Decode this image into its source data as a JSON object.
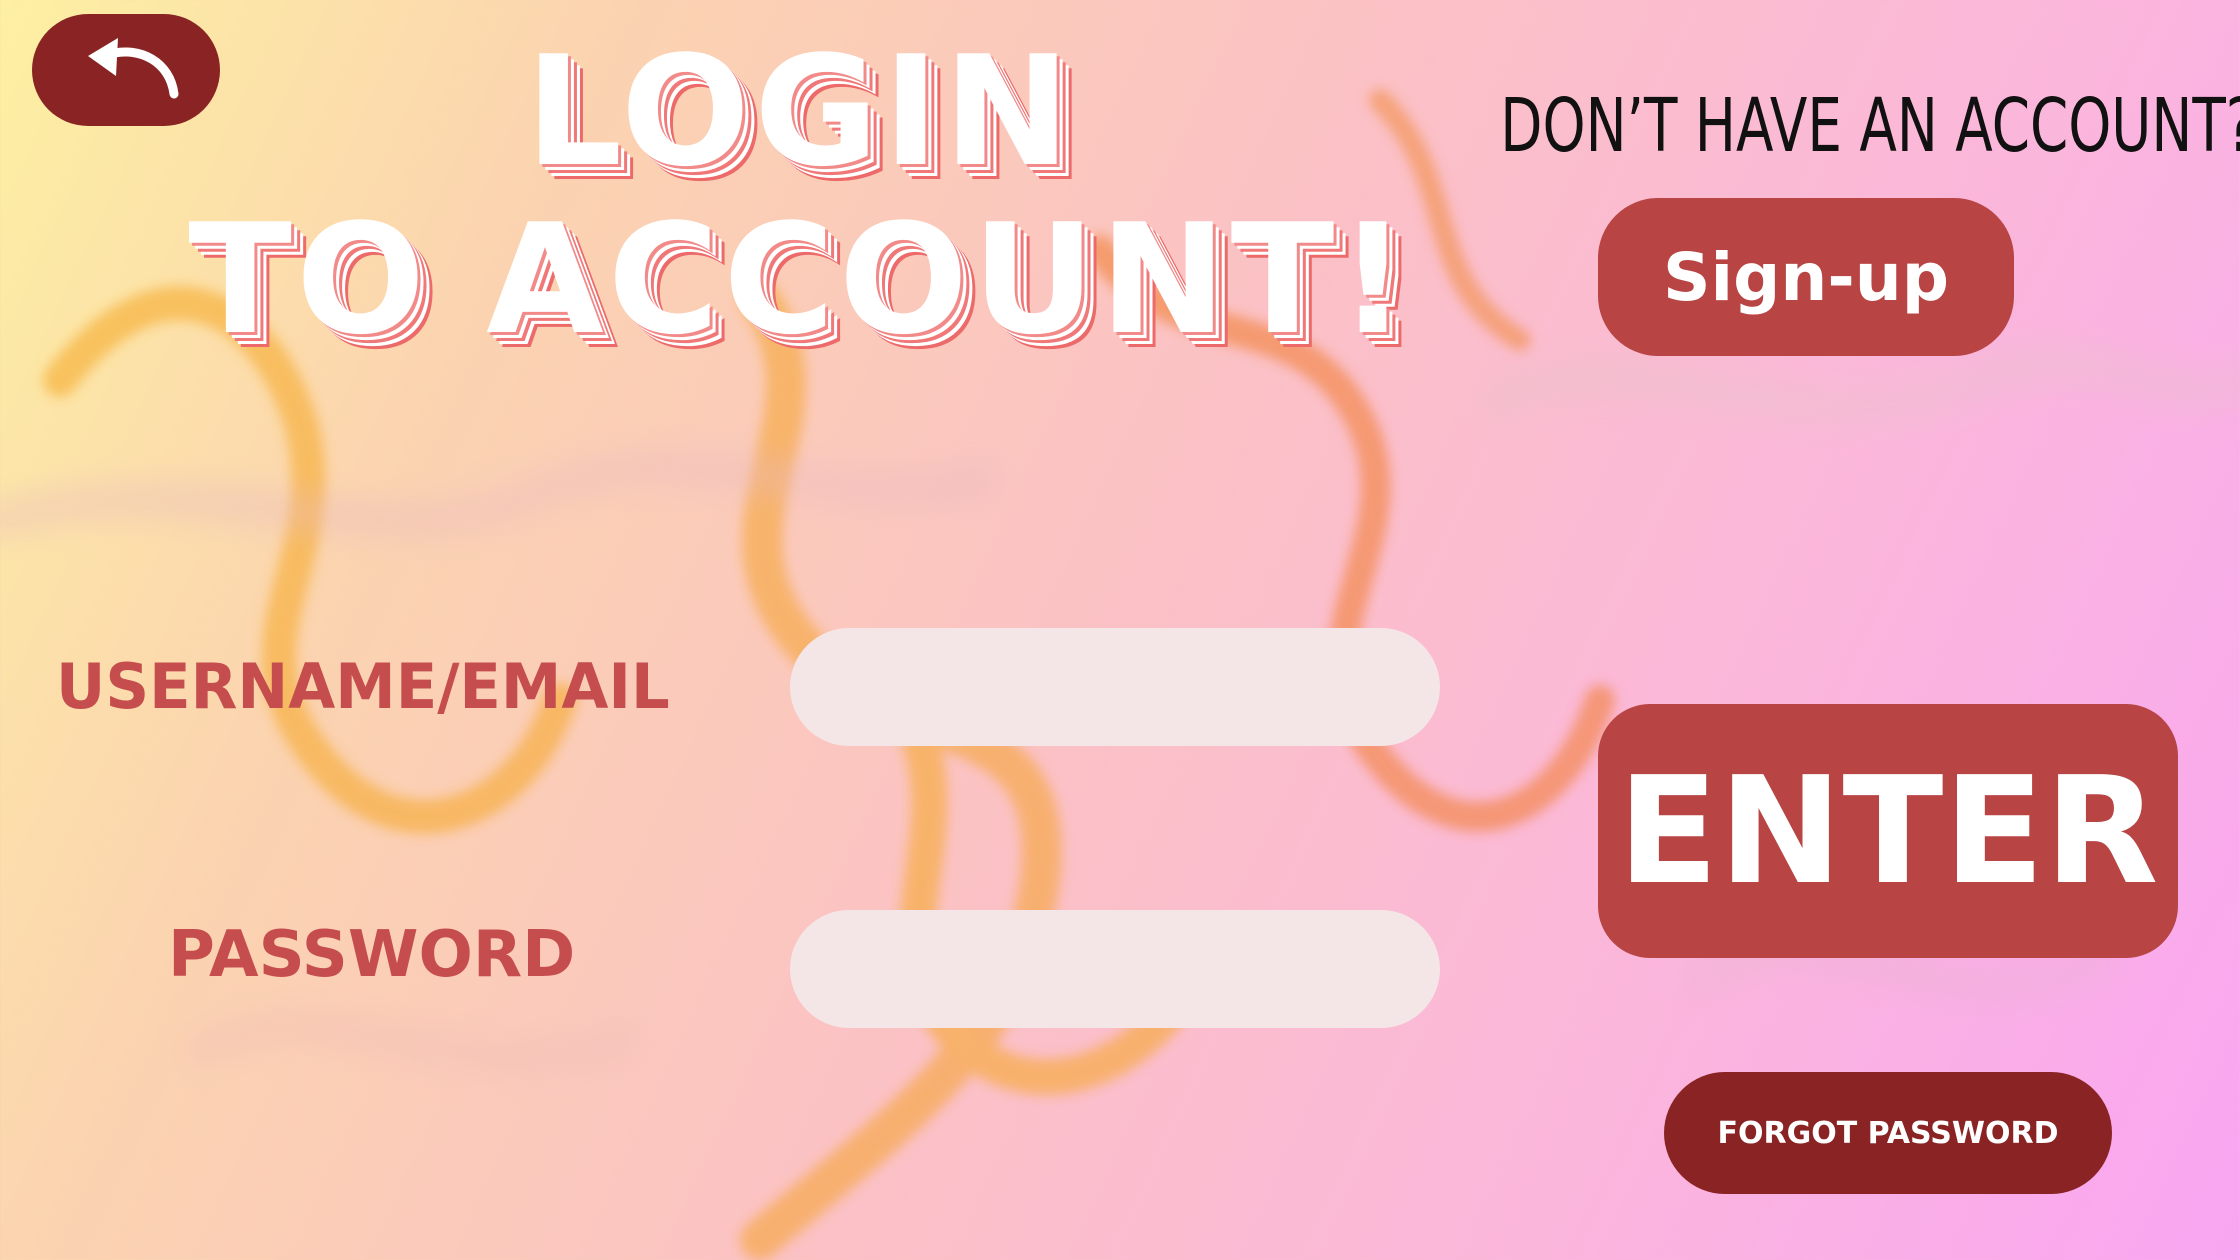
{
  "background": {
    "gradient_colors": [
      "#fdf0a2",
      "#fbc2c4",
      "#f9a6f2"
    ],
    "smoke_colors": [
      "#f5a623",
      "#f07a2a",
      "#e7c3c9"
    ]
  },
  "back": {
    "icon": "curved-arrow-back-icon",
    "color": "#8a2424"
  },
  "title": {
    "line1": "LOGIN",
    "line2": "TO ACCOUNT!"
  },
  "signup": {
    "prompt": "DON’T HAVE AN ACCOUNT?",
    "button_label": "Sign-up",
    "color": "#b84444"
  },
  "form": {
    "username_label": "USERNAME/EMAIL",
    "username_value": "",
    "password_label": "PASSWORD",
    "password_value": "",
    "label_color": "#c54d4d",
    "field_color": "#f4e6e6"
  },
  "actions": {
    "enter_label": "ENTER",
    "forgot_label": "FORGOT PASSWORD",
    "enter_color": "#b84444",
    "forgot_color": "#8a2424"
  }
}
